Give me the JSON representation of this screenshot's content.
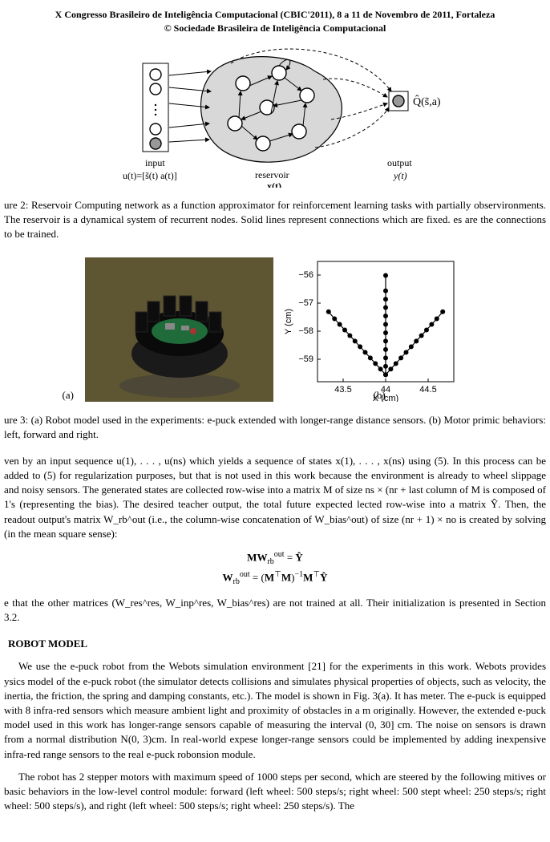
{
  "header": {
    "line1": "X Congresso Brasileiro de Inteligência Computacional (CBIC'2011), 8 a 11 de Novembro de 2011, Fortaleza",
    "line2": "© Sociedade Brasileira de Inteligência Computacional"
  },
  "fig2": {
    "input_label": "input",
    "input_formula": "u(t)=[s̃(t)  a(t)]",
    "reservoir_label": "reservoir",
    "reservoir_formula": "x(t)",
    "output_label": "output",
    "output_formula": "y(t)",
    "q_formula": "Q̂(s̃,a)",
    "caption": "ure 2: Reservoir Computing network as a function approximator for reinforcement learning tasks with partially observironments. The reservoir is a dynamical system of recurrent nodes. Solid lines represent connections which are fixed. es are the connections to be trained."
  },
  "chart_data": {
    "type": "scatter",
    "title": "",
    "xlabel": "X (cm)",
    "ylabel": "Y (cm)",
    "xlim": [
      43.2,
      44.8
    ],
    "ylim": [
      -59.8,
      -55.5
    ],
    "xticks": [
      43.5,
      44,
      44.5
    ],
    "yticks": [
      -56,
      -57,
      -58,
      -59
    ],
    "series": [
      {
        "name": "left",
        "x": [
          44.0,
          43.94,
          43.88,
          43.82,
          43.76,
          43.7,
          43.64,
          43.58,
          43.52,
          43.46,
          43.4,
          43.33
        ],
        "y": [
          -59.55,
          -59.35,
          -59.15,
          -58.95,
          -58.75,
          -58.55,
          -58.35,
          -58.15,
          -57.95,
          -57.75,
          -57.55,
          -57.3
        ]
      },
      {
        "name": "forward",
        "x": [
          44.0,
          44.0,
          44.0,
          44.0,
          44.0,
          44.0,
          44.0,
          44.0,
          44.0,
          44.0,
          44.0,
          44.0
        ],
        "y": [
          -59.55,
          -59.25,
          -58.95,
          -58.65,
          -58.35,
          -58.05,
          -57.75,
          -57.45,
          -57.15,
          -56.85,
          -56.55,
          -56.0
        ]
      },
      {
        "name": "right",
        "x": [
          44.0,
          44.06,
          44.12,
          44.18,
          44.24,
          44.3,
          44.36,
          44.42,
          44.48,
          44.54,
          44.6,
          44.67
        ],
        "y": [
          -59.55,
          -59.35,
          -59.15,
          -58.95,
          -58.75,
          -58.55,
          -58.35,
          -58.15,
          -57.95,
          -57.75,
          -57.55,
          -57.3
        ]
      }
    ]
  },
  "fig3": {
    "caption": "ure 3: (a) Robot model used in the experiments: e-puck extended with longer-range distance sensors. (b) Motor primic behaviors: left, forward and right.",
    "label_a": "(a)",
    "label_b": "(b)"
  },
  "para1": "ven by an input sequence u(1), . . . , u(ns) which yields a sequence of states x(1), . . . , x(ns) using (5). In this process can be added to (5) for regularization purposes, but that is not used in this work because the environment is already to wheel slippage and noisy sensors. The generated states are collected row-wise into a matrix M of size ns × (nr + last column of M is composed of 1's (representing the bias). The desired teacher output, the total future expected lected row-wise into a matrix Ŷ. Then, the readout output's matrix W_rb^out (i.e., the column-wise concatenation of W_bias^out) of size (nr + 1) × no is created by solving (in the mean square sense):",
  "equations": {
    "eq1": "MW_rb^out = Ŷ",
    "eq2": "W_rb^out = (M⊤M)−1M⊤Ŷ"
  },
  "para2": "e that the other matrices (W_res^res, W_inp^res, W_bias^res) are not trained at all. Their initialization is presented in Section 3.2.",
  "section": "ROBOT MODEL",
  "para3": "We use the e-puck robot from the Webots simulation environment [21] for the experiments in this work. Webots provides ysics model of the e-puck robot (the simulator detects collisions and simulates physical properties of objects, such as velocity, the inertia, the friction, the spring and damping constants, etc.). The model is shown in Fig. 3(a). It has meter. The e-puck is equipped with 8 infra-red sensors which measure ambient light and proximity of obstacles in a m originally. However, the extended e-puck model used in this work has longer-range sensors capable of measuring the interval (0, 30] cm. The noise on sensors is drawn from a normal distribution N(0, 3)cm. In real-world expese longer-range sensors could be implemented by adding inexpensive infra-red range sensors to the real e-puck robonsion module.",
  "para4": "The robot has 2 stepper motors with maximum speed of 1000 steps per second, which are steered by the following mitives or basic behaviors in the low-level control module: forward (left wheel: 500 steps/s; right wheel: 500 stept wheel: 250 steps/s; right wheel: 500 steps/s), and right (left wheel: 500 steps/s; right wheel: 250 steps/s). The"
}
